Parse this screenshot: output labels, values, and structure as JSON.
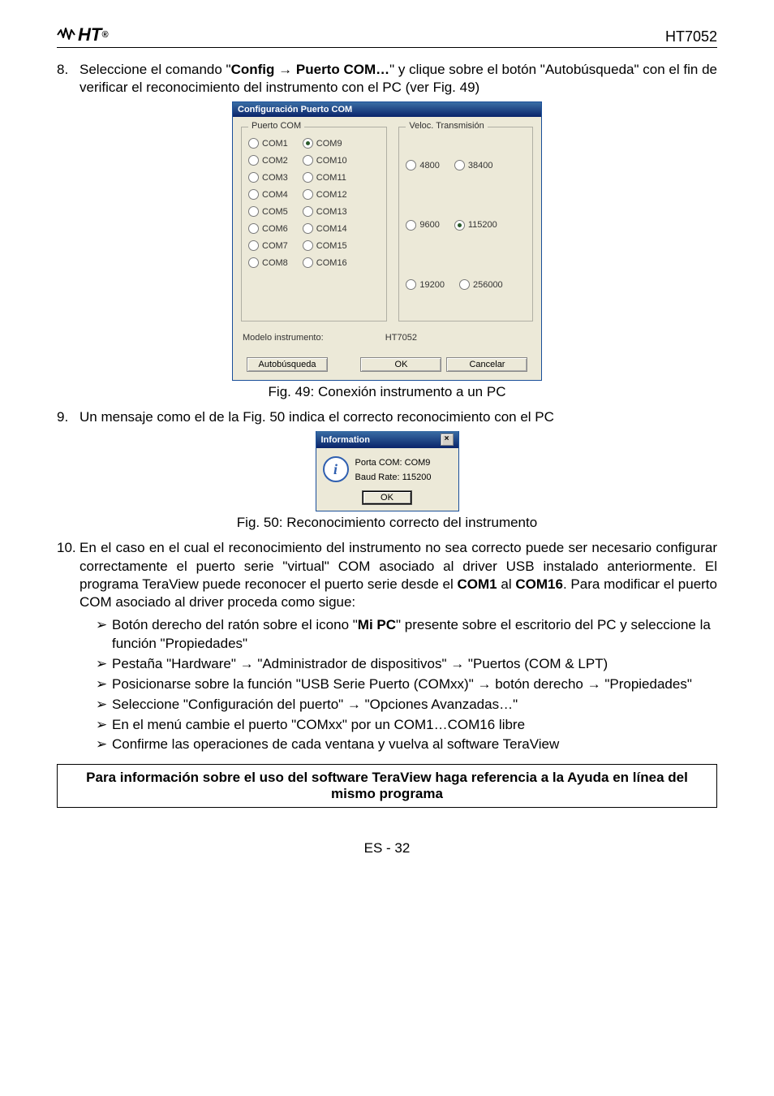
{
  "header": {
    "model": "HT7052"
  },
  "step8": {
    "num": "8.",
    "text_a": "Seleccione el comando \"",
    "bold_cmd": "Config → Puerto COM…",
    "text_b": "\" y clique sobre el botón \"Autobúsqueda\" con el fin de verificar el reconocimiento del instrumento con el PC (ver Fig. 49)"
  },
  "dlg1": {
    "title": "Configuración Puerto COM",
    "grp_ports": "Puerto COM",
    "grp_vel": "Veloc. Transmisión",
    "ports_left": [
      "COM1",
      "COM2",
      "COM3",
      "COM4",
      "COM5",
      "COM6",
      "COM7",
      "COM8"
    ],
    "ports_right": [
      "COM9",
      "COM10",
      "COM11",
      "COM12",
      "COM13",
      "COM14",
      "COM15",
      "COM16"
    ],
    "selected_port": "COM9",
    "vel_left": [
      "4800",
      "9600",
      "19200"
    ],
    "vel_right": [
      "38400",
      "115200",
      "256000"
    ],
    "selected_vel": "115200",
    "model_label": "Modelo instrumento:",
    "model_value": "HT7052",
    "btn_auto": "Autobúsqueda",
    "btn_ok": "OK",
    "btn_cancel": "Cancelar"
  },
  "fig49": "Fig. 49: Conexión instrumento a un PC",
  "step9": {
    "num": "9.",
    "text": "Un mensaje como el de la Fig. 50 indica el correcto reconocimiento con el PC"
  },
  "dlg2": {
    "title": "Information",
    "line1": "Porta COM:  COM9",
    "line2": "Baud Rate:  115200",
    "ok": "OK"
  },
  "fig50": "Fig. 50: Reconocimiento correcto del instrumento",
  "step10": {
    "num": "10.",
    "text_a": "En el caso en el cual el reconocimiento del instrumento no sea correcto puede ser necesario configurar correctamente el puerto serie \"virtual\" COM asociado al driver USB instalado anteriormente. El programa TeraView puede reconocer el puerto serie desde el ",
    "bold_range": "COM1",
    "mid": " al ",
    "bold_range2": "COM16",
    "text_b": ". Para modificar el puerto COM asociado al driver proceda como sigue:"
  },
  "bullets": [
    {
      "pre": "Botón derecho del ratón sobre el icono \"",
      "b": "Mi PC",
      "post": "\" presente sobre el escritorio del PC y seleccione la función \"Propiedades\""
    },
    {
      "plain": "Pestaña \"Hardware\" → \"Administrador de dispositivos\" → \"Puertos (COM & LPT)"
    },
    {
      "plain": "Posicionarse sobre la función \"USB Serie Puerto (COMxx)\" → botón derecho → \"Propiedades\""
    },
    {
      "plain": "Seleccione \"Configuración del puerto\" → \"Opciones Avanzadas…\""
    },
    {
      "plain": "En el menú cambie el puerto \"COMxx\" por un COM1…COM16 libre"
    },
    {
      "plain": "Confirme las operaciones de cada ventana y vuelva al software TeraView"
    }
  ],
  "note": "Para información sobre el uso del software TeraView haga referencia a la Ayuda en línea del mismo programa",
  "footer": "ES - 32"
}
